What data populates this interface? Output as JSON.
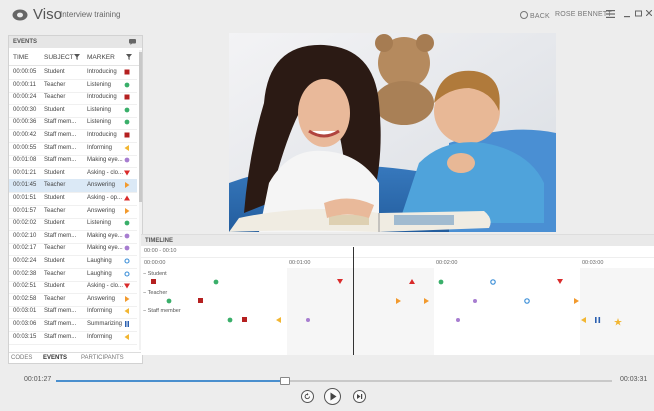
{
  "app": {
    "name": "Viso",
    "project": "Interview training"
  },
  "topnav": {
    "back": "BACK",
    "user": "ROSE BENNETT"
  },
  "events_panel": {
    "title": "EVENTS",
    "columns": {
      "time": "TIME",
      "subject": "SUBJECT",
      "marker": "MARKER"
    },
    "rows": [
      {
        "time": "00:00:05",
        "subject": "Student",
        "marker": "Introducing",
        "color": "#b52020",
        "shape": "square"
      },
      {
        "time": "00:00:11",
        "subject": "Teacher",
        "marker": "Listening",
        "color": "#3aaf6a",
        "shape": "dot"
      },
      {
        "time": "00:00:24",
        "subject": "Teacher",
        "marker": "Introducing",
        "color": "#b52020",
        "shape": "square"
      },
      {
        "time": "00:00:30",
        "subject": "Student",
        "marker": "Listening",
        "color": "#3aaf6a",
        "shape": "dot"
      },
      {
        "time": "00:00:36",
        "subject": "Staff mem...",
        "marker": "Listening",
        "color": "#3aaf6a",
        "shape": "dot"
      },
      {
        "time": "00:00:42",
        "subject": "Staff mem...",
        "marker": "Introducing",
        "color": "#b52020",
        "shape": "square"
      },
      {
        "time": "00:00:55",
        "subject": "Staff mem...",
        "marker": "Informing",
        "color": "#f2b632",
        "shape": "left"
      },
      {
        "time": "00:01:08",
        "subject": "Staff mem...",
        "marker": "Making eye...",
        "color": "#a77dd0",
        "shape": "dot"
      },
      {
        "time": "00:01:21",
        "subject": "Student",
        "marker": "Asking - clo...",
        "color": "#d92b2b",
        "shape": "down"
      },
      {
        "time": "00:01:45",
        "subject": "Teacher",
        "marker": "Answering",
        "color": "#f29a2e",
        "shape": "right"
      },
      {
        "time": "00:01:51",
        "subject": "Student",
        "marker": "Asking - op...",
        "color": "#d92b2b",
        "shape": "up"
      },
      {
        "time": "00:01:57",
        "subject": "Teacher",
        "marker": "Answering",
        "color": "#f29a2e",
        "shape": "right"
      },
      {
        "time": "00:02:02",
        "subject": "Student",
        "marker": "Listening",
        "color": "#3aaf6a",
        "shape": "dot"
      },
      {
        "time": "00:02:10",
        "subject": "Staff mem...",
        "marker": "Making eye...",
        "color": "#a77dd0",
        "shape": "dot"
      },
      {
        "time": "00:02:17",
        "subject": "Teacher",
        "marker": "Making eye...",
        "color": "#a77dd0",
        "shape": "dot"
      },
      {
        "time": "00:02:24",
        "subject": "Student",
        "marker": "Laughing",
        "color": "#3c8fd8",
        "shape": "ring"
      },
      {
        "time": "00:02:38",
        "subject": "Teacher",
        "marker": "Laughing",
        "color": "#3c8fd8",
        "shape": "ring"
      },
      {
        "time": "00:02:51",
        "subject": "Student",
        "marker": "Asking - clo...",
        "color": "#d92b2b",
        "shape": "down"
      },
      {
        "time": "00:02:58",
        "subject": "Teacher",
        "marker": "Answering",
        "color": "#f29a2e",
        "shape": "right"
      },
      {
        "time": "00:03:01",
        "subject": "Staff mem...",
        "marker": "Informing",
        "color": "#f2b632",
        "shape": "left"
      },
      {
        "time": "00:03:06",
        "subject": "Staff mem...",
        "marker": "Summarizing",
        "color": "#2a5fb0",
        "shape": "pause"
      },
      {
        "time": "00:03:15",
        "subject": "Staff mem...",
        "marker": "Informing",
        "color": "#f2b632",
        "shape": "left"
      }
    ],
    "selected_row_index": 9,
    "tabs": [
      "CODES",
      "EVENTS",
      "PARTICIPANTS"
    ],
    "active_tab_index": 1
  },
  "timeline": {
    "title": "TIMELINE",
    "range": "00:00 - 00:10",
    "ticks": [
      "00:00:00",
      "00:01:00",
      "00:02:00",
      "00:03:00"
    ],
    "tracks": [
      "Student",
      "Teacher",
      "Staff member"
    ]
  },
  "player": {
    "current": "00:01:27",
    "duration": "00:03:31",
    "progress": 0.41
  },
  "icons": {
    "logo": "viso-logo-icon",
    "back": "back-icon",
    "menu": "hamburger-menu-icon",
    "comment": "comment-icon",
    "filter": "filter-icon",
    "rewind": "rewind-icon",
    "play": "play-icon",
    "forward": "forward-icon"
  }
}
